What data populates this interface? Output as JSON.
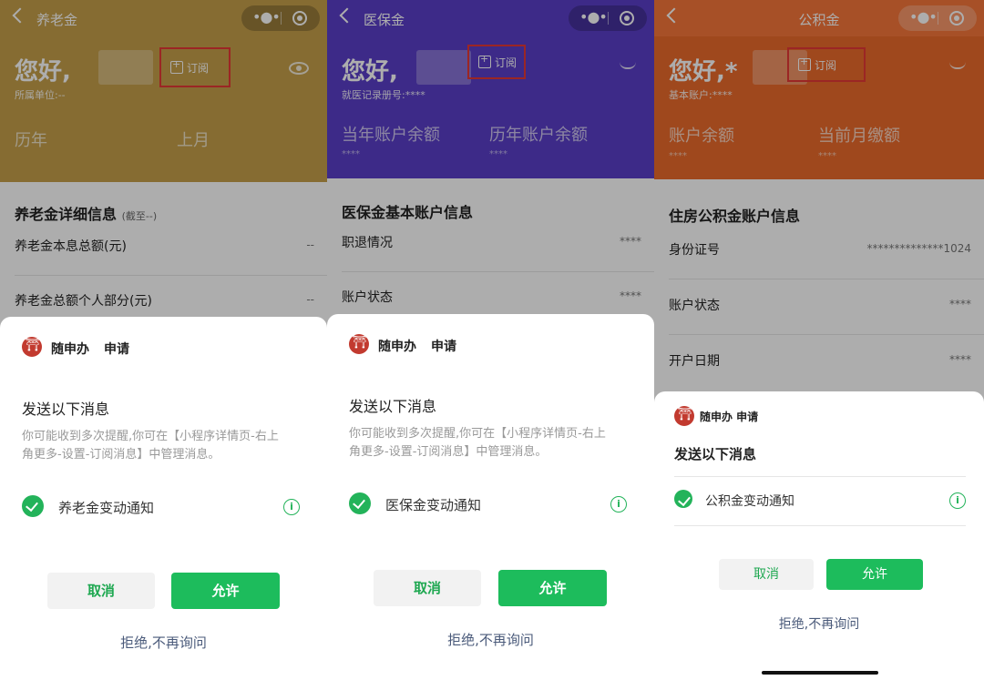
{
  "panels": [
    {
      "nav_title": "养老金",
      "hello": "您好,",
      "sub_info": "所属单位:--",
      "subscribe_label": "订阅",
      "stats": [
        {
          "label": "历年",
          "value": ""
        },
        {
          "label": "上月",
          "value": ""
        }
      ],
      "section_title": "养老金详细信息",
      "section_note": "(截至--)",
      "rows": [
        {
          "label": "养老金本息总额(元)",
          "value": "--"
        },
        {
          "label": "养老金总额个人部分(元)",
          "value": "--"
        }
      ],
      "sheet": {
        "app_name": "随申办",
        "apply": "申请",
        "send_title": "发送以下消息",
        "desc_line1": "你可能收到多次提醒,你可在【小程序详情页-右上",
        "desc_line2": "角更多-设置-订阅消息】中管理消息。",
        "notice": "养老金变动通知",
        "cancel": "取消",
        "allow": "允许",
        "refuse": "拒绝,不再询问"
      },
      "theme_color": "#c6a04b"
    },
    {
      "nav_title": "医保金",
      "hello": "您好,",
      "sub_info": "就医记录册号:****",
      "subscribe_label": "订阅",
      "stats": [
        {
          "label": "当年账户余额",
          "value": "****"
        },
        {
          "label": "历年账户余额",
          "value": "****"
        }
      ],
      "section_title": "医保金基本账户信息",
      "rows": [
        {
          "label": "职退情况",
          "value": "****"
        },
        {
          "label": "账户状态",
          "value": "****"
        }
      ],
      "sheet": {
        "app_name": "随申办",
        "apply": "申请",
        "send_title": "发送以下消息",
        "desc_line1": "你可能收到多次提醒,你可在【小程序详情页-右上",
        "desc_line2": "角更多-设置-订阅消息】中管理消息。",
        "notice": "医保金变动通知",
        "cancel": "取消",
        "allow": "允许",
        "refuse": "拒绝,不再询问"
      },
      "theme_color": "#5a3fc9"
    },
    {
      "nav_title": "公积金",
      "hello": "您好,*",
      "sub_info": "基本账户:****",
      "subscribe_label": "订阅",
      "stats": [
        {
          "label": "账户余额",
          "value": "****"
        },
        {
          "label": "当前月缴额",
          "value": "****"
        }
      ],
      "section_title": "住房公积金账户信息",
      "rows": [
        {
          "label": "身份证号",
          "value": "**************1024"
        },
        {
          "label": "账户状态",
          "value": "****"
        },
        {
          "label": "开户日期",
          "value": "****"
        }
      ],
      "sheet": {
        "app_name": "随申办 申请",
        "send_title": "发送以下消息",
        "notice": "公积金变动通知",
        "cancel": "取消",
        "allow": "允许",
        "refuse": "拒绝,不再询问"
      },
      "theme_color": "#ea6b2c"
    }
  ]
}
